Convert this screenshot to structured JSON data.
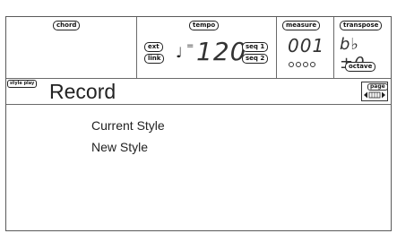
{
  "status": {
    "chord_label": "chord",
    "tempo_label": "tempo",
    "ext_label": "ext",
    "link_label": "link",
    "seq1_label": "seq 1",
    "seq2_label": "seq 2",
    "tempo_value": "120",
    "measure_label": "measure",
    "measure_value": "001",
    "transpose_label": "transpose",
    "transpose_value": "b♭ ±0",
    "octave_label": "octave"
  },
  "header": {
    "mode_tag": "style play",
    "title": "Record",
    "page_label": "page"
  },
  "menu": {
    "items": [
      {
        "label": "Current Style"
      },
      {
        "label": "New Style"
      }
    ]
  },
  "icons": {
    "note": "quarter-note-icon",
    "page_arrows": "page-arrows-icon"
  }
}
